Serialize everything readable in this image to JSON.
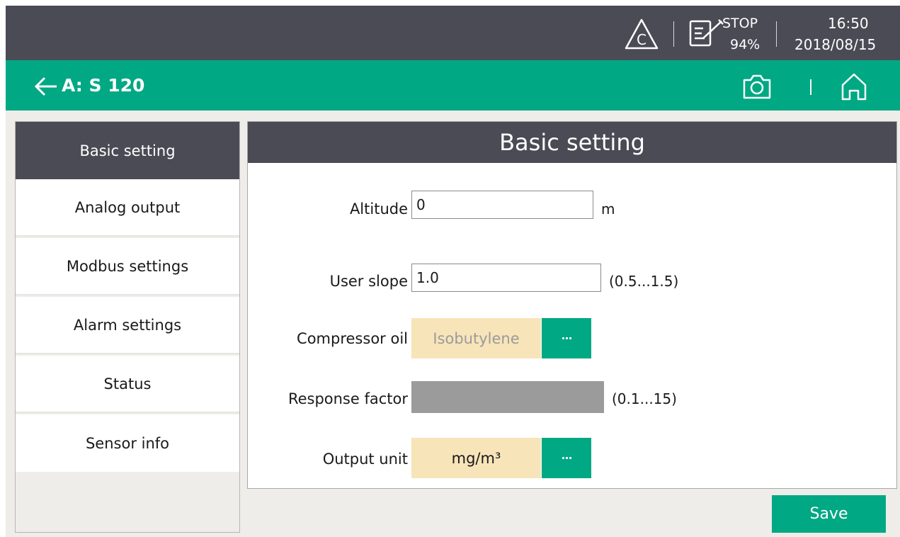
{
  "status_bar": {
    "calibration_icon": "triangle-c-icon",
    "log_icon": "notepad-pen-icon",
    "log_state": "STOP",
    "memory": "94%",
    "time": "16:50",
    "date": "2018/08/15"
  },
  "title_bar": {
    "back_icon": "arrow-left-icon",
    "title": "A: S 120",
    "camera_icon": "camera-icon",
    "home_icon": "home-icon"
  },
  "sidebar": {
    "items": [
      {
        "label": "Basic setting",
        "active": true
      },
      {
        "label": "Analog output",
        "active": false
      },
      {
        "label": "Modbus settings",
        "active": false
      },
      {
        "label": "Alarm settings",
        "active": false
      },
      {
        "label": "Status",
        "active": false
      },
      {
        "label": "Sensor info",
        "active": false
      }
    ]
  },
  "panel": {
    "title": "Basic setting",
    "altitude": {
      "label": "Altitude",
      "value": "0",
      "unit": "m"
    },
    "user_slope": {
      "label": "User slope",
      "value": "1.0",
      "range": "(0.5...1.5)"
    },
    "compressor_oil": {
      "label": "Compressor oil",
      "value": "Isobutylene",
      "more_icon": "ellipsis-icon"
    },
    "response_factor": {
      "label": "Response factor",
      "range": "(0.1...15)"
    },
    "output_unit": {
      "label": "Output unit",
      "value": "mg/m³",
      "more_icon": "ellipsis-icon"
    }
  },
  "actions": {
    "save_label": "Save"
  },
  "colors": {
    "accent": "#00a884",
    "dark": "#4a4b55",
    "select_bg": "#f7e4b9",
    "disabled": "#9b9b9b",
    "background": "#efedea"
  }
}
